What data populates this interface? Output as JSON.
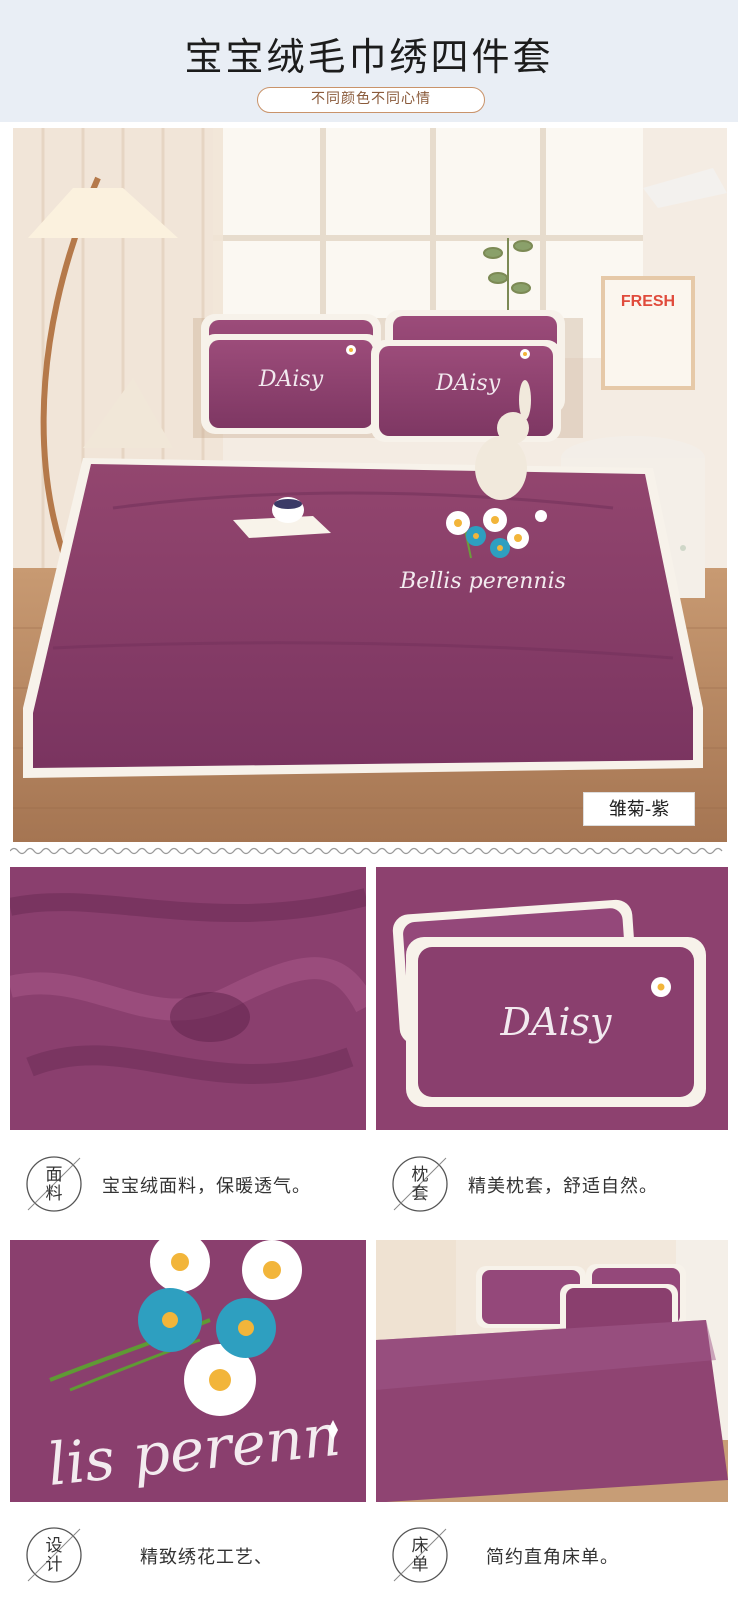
{
  "header": {
    "title": "宝宝绒毛巾绣四件套",
    "subtitle": "不同颜色不同心情"
  },
  "hero": {
    "color_tag": "雏菊-紫",
    "pillow_logo": "DAisy",
    "embroidery_text": "Bellis perennis",
    "poster_text": "FRESH"
  },
  "features": [
    {
      "badge": [
        "面",
        "料"
      ],
      "text": "宝宝绒面料，保暖透气。"
    },
    {
      "badge": [
        "枕",
        "套"
      ],
      "text": "精美枕套，舒适自然。"
    },
    {
      "badge": [
        "设",
        "计"
      ],
      "text": "精致绣花工艺、"
    },
    {
      "badge": [
        "床",
        "单"
      ],
      "text": "简约直角床单。"
    }
  ],
  "details": {
    "pillow_logo": "DAisy",
    "embroidery_text": "lis perenn"
  },
  "colors": {
    "header_bg": "#e9eef5",
    "fabric_purple": "#8a3f6e",
    "fabric_dark": "#6e2d57",
    "pill_border": "#c9936a",
    "trim_white": "#f7f2ea"
  }
}
